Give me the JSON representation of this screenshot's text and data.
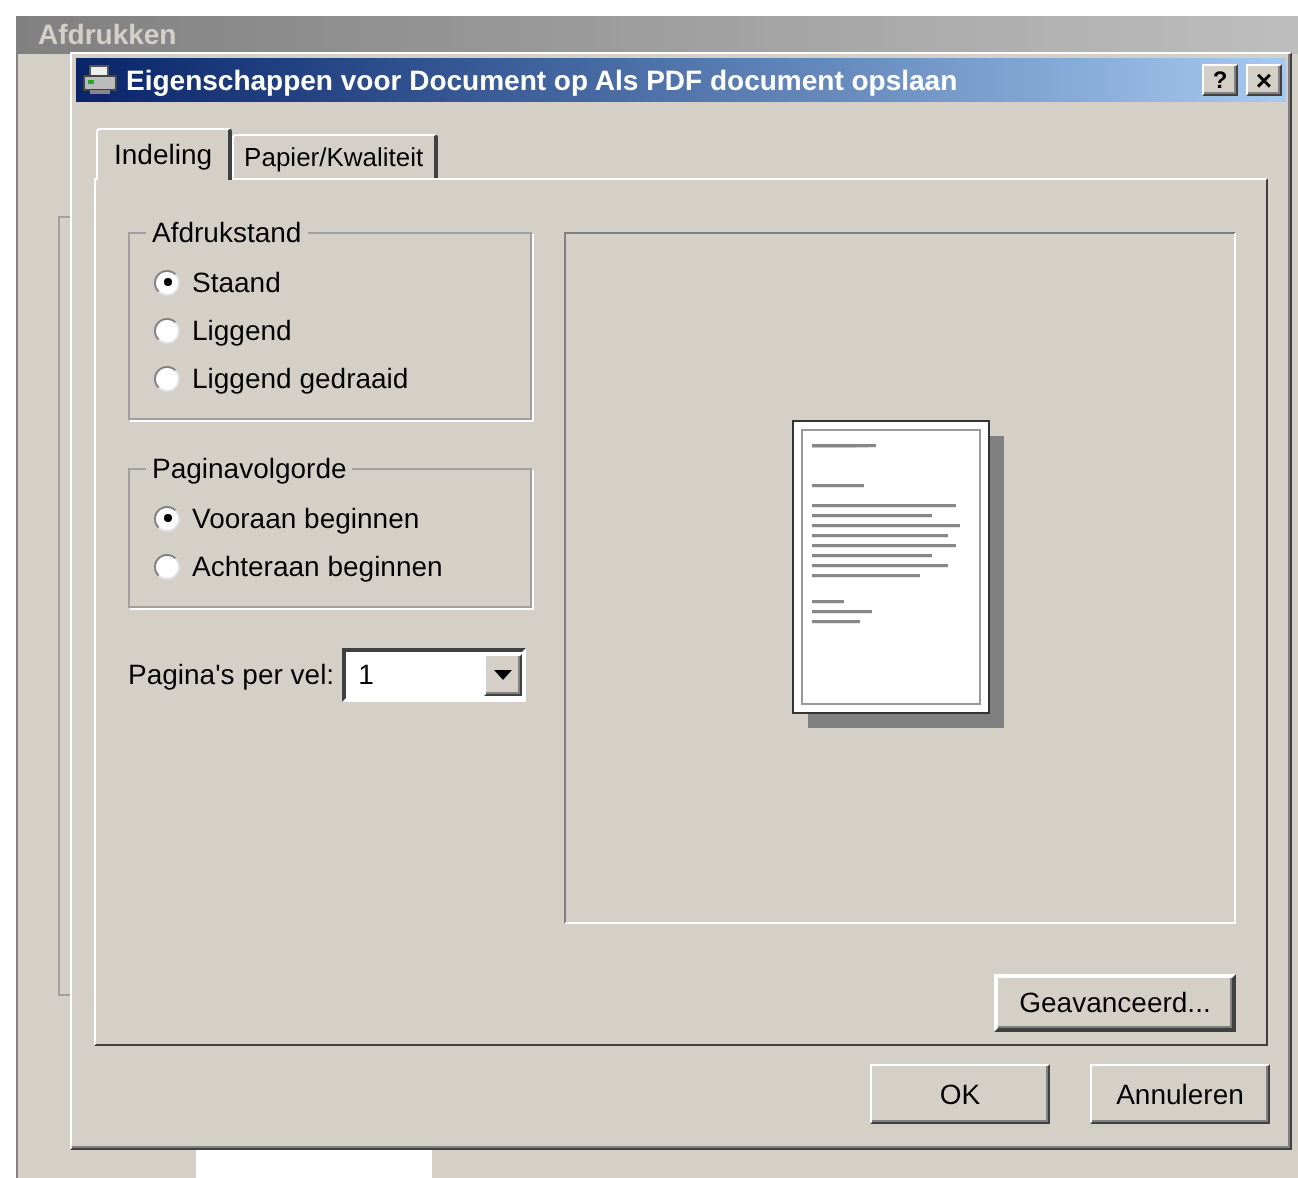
{
  "background_window": {
    "title": "Afdrukken"
  },
  "dialog": {
    "title": "Eigenschappen voor Document op Als PDF document opslaan",
    "help_button": "?",
    "close_button": "×"
  },
  "tabs": [
    {
      "label": "Indeling",
      "selected": true
    },
    {
      "label": "Papier/Kwaliteit",
      "selected": false
    }
  ],
  "groups": [
    {
      "title": "Afdrukstand",
      "options": [
        {
          "label": "Staand",
          "selected": true
        },
        {
          "label": "Liggend",
          "selected": false
        },
        {
          "label": "Liggend gedraaid",
          "selected": false
        }
      ]
    },
    {
      "title": "Paginavolgorde",
      "options": [
        {
          "label": "Vooraan beginnen",
          "selected": true
        },
        {
          "label": "Achteraan beginnen",
          "selected": false
        }
      ]
    }
  ],
  "pages_per_sheet": {
    "label": "Pagina's per vel:",
    "value": "1"
  },
  "preview": {
    "kind": "portrait"
  },
  "advanced_button": "Geavanceerd...",
  "buttons": [
    "OK",
    "Annuleren"
  ]
}
